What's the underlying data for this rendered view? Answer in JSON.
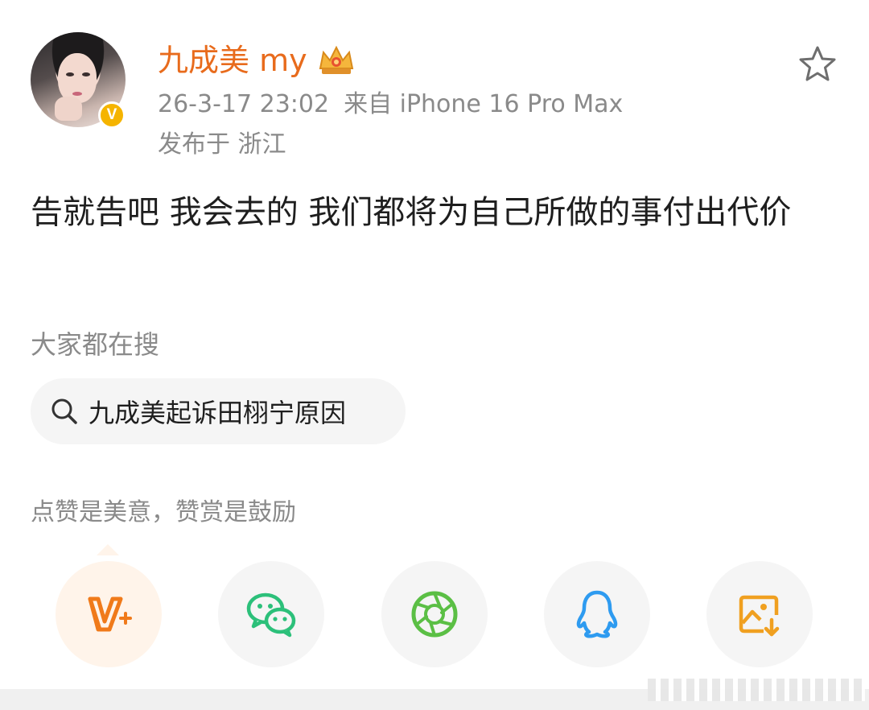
{
  "post": {
    "author": {
      "name": "九成美 my",
      "verified_badge": "V",
      "crown_icon": "crown-icon",
      "accent_color": "#e86b1c"
    },
    "timestamp": "26-3-17 23:02",
    "source": "来自 iPhone 16 Pro Max",
    "location": "发布于 浙江",
    "content": "告就告吧 我会去的 我们都将为自己所做的事付出代价"
  },
  "search_section": {
    "title": "大家都在搜",
    "query": "九成美起诉田栩宁原因"
  },
  "reward": {
    "text": "点赞是美意，赞赏是鼓励"
  },
  "share_buttons": [
    {
      "icon": "weibo-vplus-icon"
    },
    {
      "icon": "wechat-icon"
    },
    {
      "icon": "moments-icon"
    },
    {
      "icon": "qq-icon"
    },
    {
      "icon": "save-image-icon"
    }
  ]
}
